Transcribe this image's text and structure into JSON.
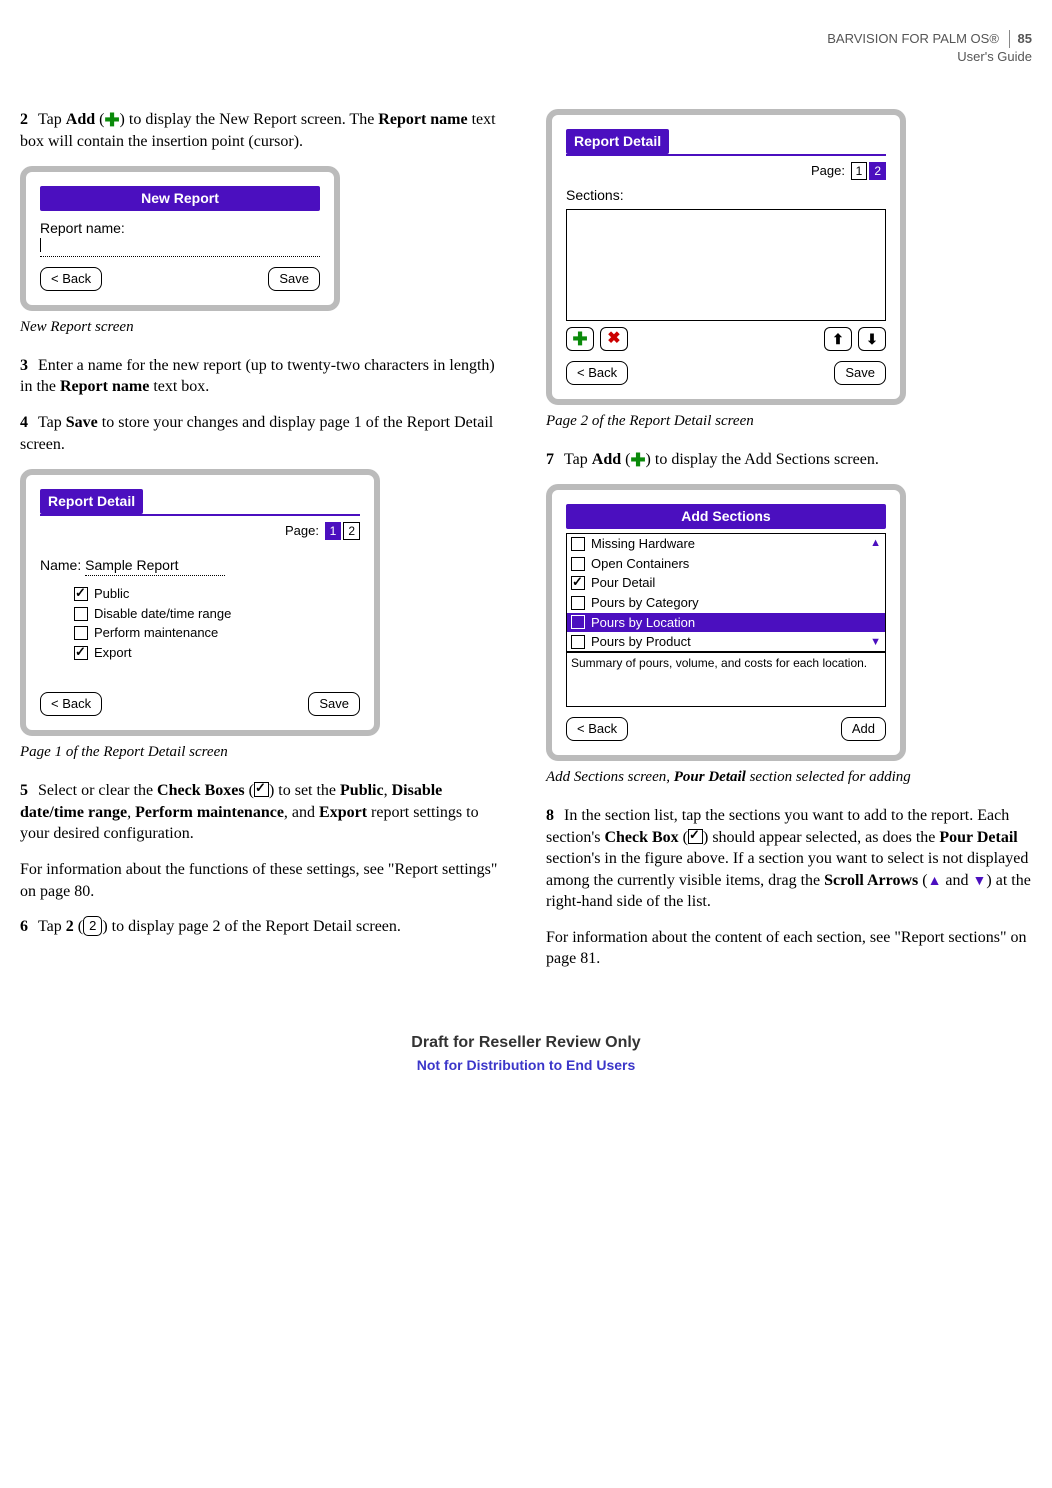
{
  "header": {
    "product_line": "BARVISION FOR PALM OS®",
    "guide_line": "User's Guide",
    "page_number": "85"
  },
  "left": {
    "step2_num": "2",
    "step2_pre": "Tap ",
    "step2_bold1": "Add",
    "step2_mid1": " (",
    "step2_mid2": ") to display the New Report screen. The ",
    "step2_bold2": "Report name",
    "step2_post": " text box will contain the insertion point (cursor).",
    "fig1_caption": "New Report screen",
    "step3_num": "3",
    "step3_pre": "Enter a name for the new report (up to twenty-two characters in length) in the ",
    "step3_bold": "Report name",
    "step3_post": " text box.",
    "step4_num": "4",
    "step4_pre": "Tap ",
    "step4_bold": "Save",
    "step4_post": " to store your changes and display page 1 of the Report Detail screen.",
    "fig2_caption": "Page 1 of the Report Detail screen",
    "step5_num": "5",
    "step5_pre": "Select or clear the ",
    "step5_b1": "Check Boxes",
    "step5_m1": " (",
    "step5_m2": ") to set the ",
    "step5_b2": "Public",
    "step5_c1": ", ",
    "step5_b3": "Disable date/time range",
    "step5_c2": ", ",
    "step5_b4": "Perform maintenance",
    "step5_c3": ", and ",
    "step5_b5": "Export",
    "step5_post": " report settings to your desired configuration.",
    "step5_info": "For information about the functions of these settings, see \"Report settings\" on page 80.",
    "step6_num": "6",
    "step6_pre": "Tap ",
    "step6_bold": "2",
    "step6_mid": " (",
    "step6_post": ") to display page 2 of the Report Detail screen."
  },
  "right": {
    "fig3_caption": "Page 2 of the Report Detail screen",
    "step7_num": "7",
    "step7_pre": "Tap ",
    "step7_bold": "Add",
    "step7_mid1": " (",
    "step7_post": ") to display the Add Sections screen.",
    "fig4_caption_pre": "Add Sections screen, ",
    "fig4_caption_bold": "Pour Detail",
    "fig4_caption_post": " section selected for adding",
    "step8_num": "8",
    "step8_pre": "In the section list, tap the sections you want to add to the report. Each section's ",
    "step8_b1": "Check Box",
    "step8_m1": " (",
    "step8_m2": ") should appear selected, as does the ",
    "step8_b2": "Pour Detail",
    "step8_m3": " section's in the figure above. If a section you want to select is not displayed among the currently visible items, drag the ",
    "step8_b3": "Scroll Arrows",
    "step8_m4": " (",
    "step8_and": " and ",
    "step8_post": ") at the right-hand side of the list.",
    "step8_info": "For information about the content of each section, see \"Report sections\" on page 81."
  },
  "screens": {
    "new_report": {
      "title": "New Report",
      "label": "Report name:",
      "back": "< Back",
      "save": "Save"
    },
    "rd1": {
      "title": "Report Detail",
      "page_label": "Page:",
      "p1": "1",
      "p2": "2",
      "name_label": "Name:",
      "name_value": "Sample Report",
      "opt1": "Public",
      "opt2": "Disable date/time range",
      "opt3": "Perform maintenance",
      "opt4": "Export",
      "back": "< Back",
      "save": "Save"
    },
    "rd2": {
      "title": "Report Detail",
      "page_label": "Page:",
      "p1": "1",
      "p2": "2",
      "sections_label": "Sections:",
      "back": "< Back",
      "save": "Save"
    },
    "add_sections": {
      "title": "Add Sections",
      "items": {
        "i0": "Missing Hardware",
        "i1": "Open Containers",
        "i2": "Pour Detail",
        "i3": "Pours by Category",
        "i4": "Pours by Location",
        "i5": "Pours by Product"
      },
      "desc": "Summary of pours, volume, and costs for each location.",
      "back": "< Back",
      "add": "Add"
    }
  },
  "footer": {
    "l1": "Draft for Reseller Review Only",
    "l2": "Not for Distribution to End Users"
  },
  "glyphs": {
    "page2": "2",
    "up": "▲",
    "down": "▼"
  }
}
